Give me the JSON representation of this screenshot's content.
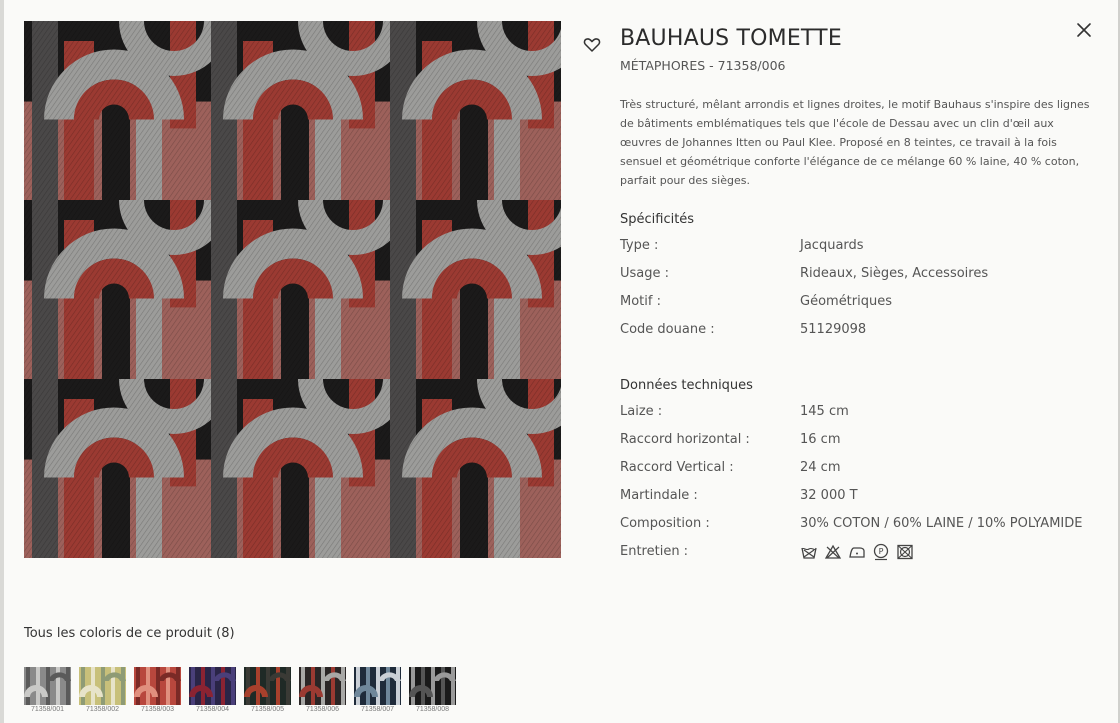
{
  "product": {
    "title": "BAUHAUS TOMETTE",
    "subtitle": "MÉTAPHORES - 71358/006",
    "description": "Très structuré, mêlant arrondis et lignes droites, le motif Bauhaus s'inspire des lignes de bâtiments emblématiques tels que l'école de Dessau avec un clin d'œil aux œuvres de Johannes Itten ou Paul Klee. Proposé en 8 teintes, ce travail à la fois sensuel et géométrique conforte l'élégance de ce mélange 60 % laine, 40 % coton, parfait pour des sièges."
  },
  "specs": {
    "heading": "Spécificités",
    "rows": [
      {
        "label": "Type :",
        "value": "Jacquards"
      },
      {
        "label": "Usage :",
        "value": "Rideaux, Sièges, Accessoires"
      },
      {
        "label": "Motif :",
        "value": "Géométriques"
      },
      {
        "label": "Code douane :",
        "value": "51129098"
      }
    ]
  },
  "tech": {
    "heading": "Données techniques",
    "rows": [
      {
        "label": "Laize :",
        "value": "145 cm"
      },
      {
        "label": "Raccord horizontal :",
        "value": "16 cm"
      },
      {
        "label": "Raccord Vertical :",
        "value": "24 cm"
      },
      {
        "label": "Martindale :",
        "value": "32 000 T"
      },
      {
        "label": "Composition :",
        "value": " 30% COTON / 60% LAINE / 10% POLYAMIDE"
      },
      {
        "label": "Entretien :",
        "value": ""
      }
    ],
    "care_icons": [
      "wash-30-icon",
      "no-bleach-icon",
      "iron-low-icon",
      "dry-clean-p-icon",
      "no-tumble-dry-icon"
    ]
  },
  "colorways": {
    "heading": "Tous les coloris de ce produit (8)",
    "items": [
      {
        "code": "71358/001",
        "colors": [
          "#8a8a8a",
          "#c9c9c7",
          "#5a5a5a"
        ]
      },
      {
        "code": "71358/002",
        "colors": [
          "#c8c07a",
          "#e7e3c9",
          "#8e9b75"
        ]
      },
      {
        "code": "71358/003",
        "colors": [
          "#b8473d",
          "#e08f7e",
          "#7a2a26"
        ]
      },
      {
        "code": "71358/004",
        "colors": [
          "#2a2547",
          "#8b2332",
          "#4a3f7a"
        ]
      },
      {
        "code": "71358/005",
        "colors": [
          "#1f2a26",
          "#a7402c",
          "#3a3a35"
        ]
      },
      {
        "code": "71358/006",
        "colors": [
          "#2a2626",
          "#9b3a32",
          "#a8a8a6"
        ]
      },
      {
        "code": "71358/007",
        "colors": [
          "#1f2b3a",
          "#6f879a",
          "#c9cfd6"
        ]
      },
      {
        "code": "71358/008",
        "colors": [
          "#1a1a1a",
          "#555555",
          "#9a9a9a"
        ]
      }
    ]
  },
  "colors": {
    "fabric_dark": "#1b1a1a",
    "fabric_red": "#9b3a32",
    "fabric_pink": "#c97a72",
    "fabric_grey": "#9c9c9a",
    "fabric_darkgrey": "#4a4848"
  }
}
